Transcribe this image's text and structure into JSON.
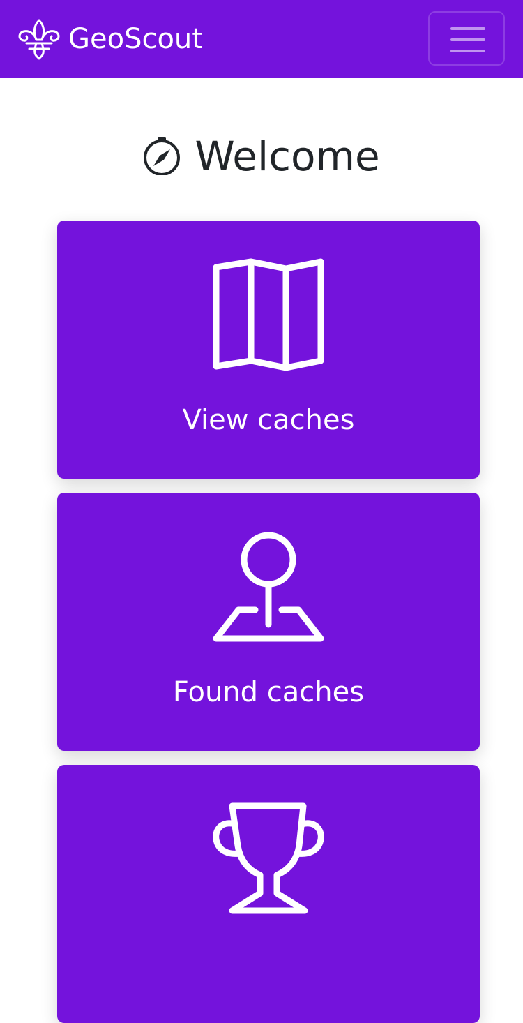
{
  "navbar": {
    "brand_name": "GeoScout",
    "brand_logo_icon": "fleur-de-lis-icon",
    "menu_icon": "hamburger-menu-icon",
    "background_color": "#7413dc"
  },
  "heading": {
    "icon": "compass-icon",
    "title": "Welcome"
  },
  "tiles": [
    {
      "icon": "map-icon",
      "label": "View caches"
    },
    {
      "icon": "map-pin-icon",
      "label": "Found caches"
    },
    {
      "icon": "trophy-icon",
      "label": ""
    }
  ],
  "colors": {
    "accent": "#7413dc",
    "text": "#212529",
    "on_accent": "#ffffff"
  }
}
